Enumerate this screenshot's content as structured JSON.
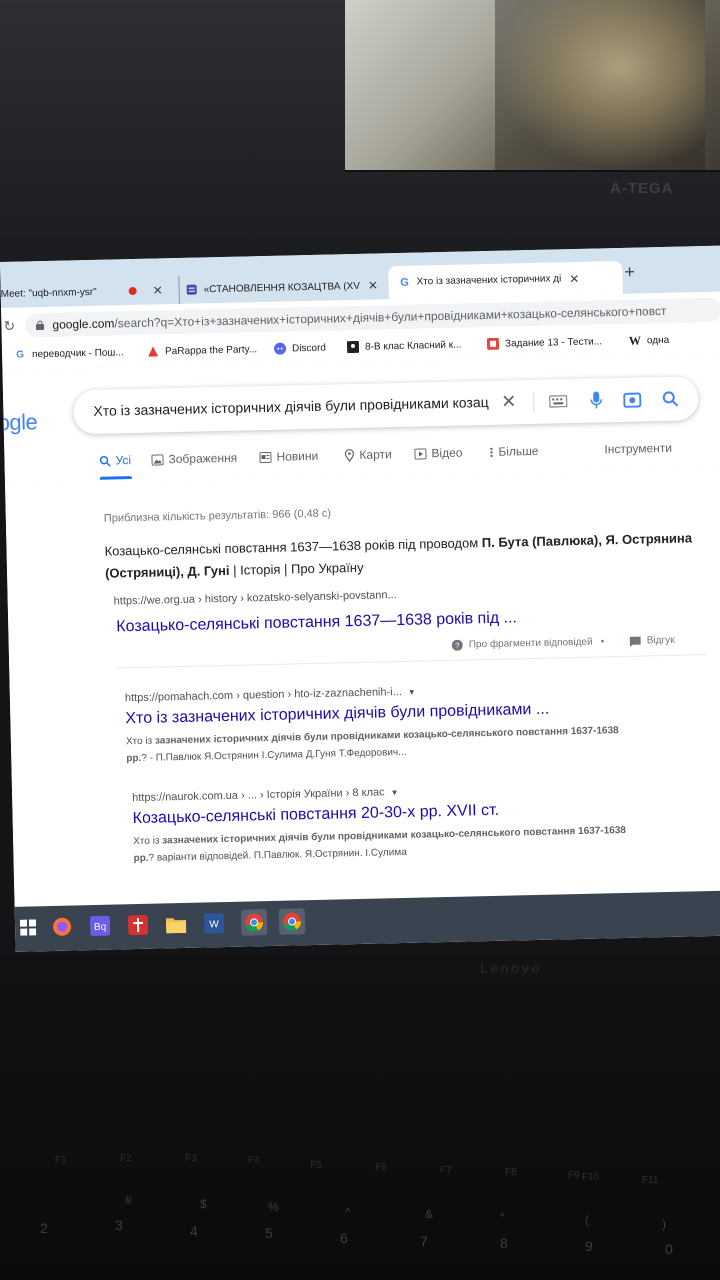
{
  "browser": {
    "tabs": [
      {
        "title": "Meet: \"uqb-nnxm-ysr\"",
        "active": false
      },
      {
        "title": "«СТАНОВЛЕННЯ КОЗАЦТВА (XV",
        "active": false
      },
      {
        "title": "Хто із зазначених історичних ді",
        "active": true
      }
    ],
    "new_tab": "+",
    "url_host": "google.com",
    "url_rest": "/search?q=Хто+із+зазначених+історичних+діячів+були+провідниками+козацько-селянського+повст"
  },
  "bookmarks": [
    {
      "label": "переводчик - Пош...",
      "icon": "google-icon"
    },
    {
      "label": "PaRappa the Party...",
      "icon": "parappa-icon"
    },
    {
      "label": "Discord",
      "icon": "discord-icon"
    },
    {
      "label": "8-В клас Класний к...",
      "icon": "classroom-icon"
    },
    {
      "label": "Задание 13 - Тести...",
      "icon": "page-icon"
    },
    {
      "label": "одна",
      "icon": "wikipedia-icon"
    }
  ],
  "google": {
    "logo": "ogle",
    "query": "Хто із зазначених історичних діячів були провідниками козац",
    "tabs": [
      {
        "label": "Усі",
        "icon": "search-icon",
        "active": true
      },
      {
        "label": "Зображення",
        "icon": "image-icon"
      },
      {
        "label": "Новини",
        "icon": "news-icon"
      },
      {
        "label": "Карти",
        "icon": "pin-icon"
      },
      {
        "label": "Відео",
        "icon": "video-icon"
      },
      {
        "label": "Більше",
        "icon": "more-icon"
      }
    ],
    "tools": "Інструменти"
  },
  "results": {
    "stats": "Приблизна кількість результатів: 966 (0,48 с)",
    "featured": {
      "text_plain": "Козацько-селянські повстання 1637—1638 років під проводом ",
      "text_bold1": "П. Бута (Павлюка), Я. Острянина (Остряниці), Д. Гуні",
      "text_tail": " | Історія | Про Україну",
      "cite": "https://we.org.ua › history › kozatsko-selyanski-povstann...",
      "link": "Козацько-селянські повстання 1637—1638 років під ...",
      "about": "Про фрагменти відповідей",
      "dot": "•",
      "feedback": "Відгук"
    },
    "items": [
      {
        "cite": "https://pomahach.com › question › hto-iz-zaznachenih-i...",
        "link": "Хто із зазначених історичних діячів були провідниками ...",
        "desc_lead": "Хто із ",
        "desc_bold": "зазначених історичних діячів були провідниками козацько-селянського повстання 1637-1638 рр.",
        "desc_tail": "? - П.Павлюк Я.Острянин І.Сулима Д.Гуня Т.Федорович..."
      },
      {
        "cite": "https://naurok.com.ua › ... › Історія України › 8 клас",
        "link": "Козацько-селянські повстання 20-30-х рр. XVII ст.",
        "desc_lead": "Хто із ",
        "desc_bold": "зазначених історичних діячів були провідниками козацько-селянського повстання 1637-1638 рр.",
        "desc_tail": "? варіанти відповідей. П.Павлюк. Я.Острянин. І.Сулима"
      }
    ]
  },
  "taskbar": [
    "windows-start-icon",
    "firefox-icon",
    "app-bq-icon",
    "app-red-icon",
    "file-explorer-icon",
    "word-icon",
    "chrome-icon",
    "chrome-icon"
  ],
  "laptop": {
    "bezel_brand": "A-TEGA",
    "keyboard_brand": "Lenovo"
  },
  "keyboard": {
    "fkeys": [
      "F1",
      "F2",
      "F3",
      "F4",
      "F5",
      "F6",
      "F7",
      "F8",
      "F9",
      "F10",
      "F11"
    ],
    "numbers": [
      "2",
      "3",
      "4",
      "5",
      "6",
      "7",
      "8",
      "9",
      "0"
    ],
    "symbols": [
      "#",
      "$",
      "%",
      "^",
      "&",
      "*",
      "(",
      ")"
    ]
  }
}
